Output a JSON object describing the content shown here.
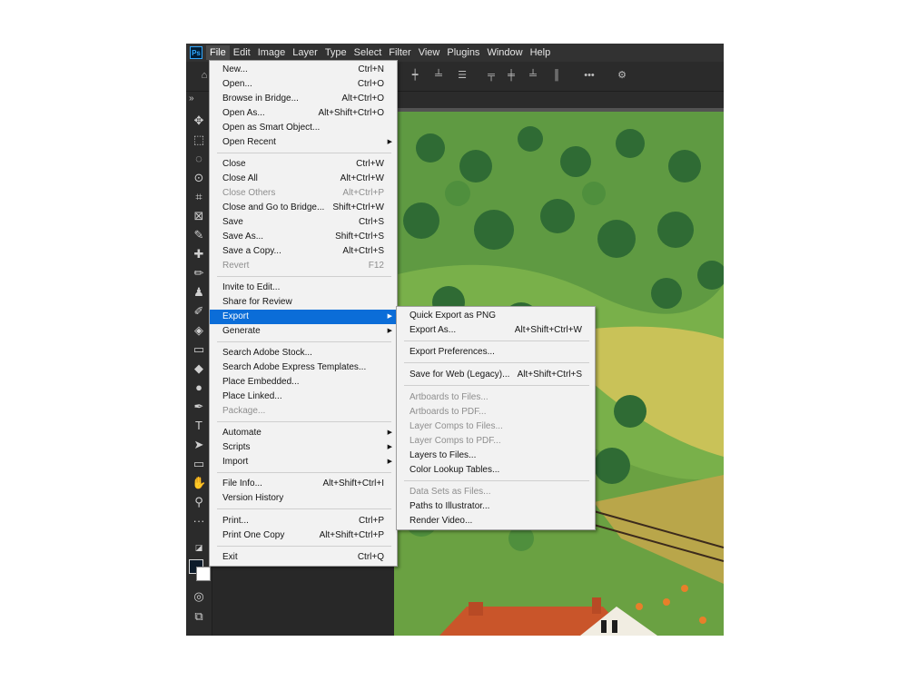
{
  "app": {
    "logo": "Ps"
  },
  "menubar": {
    "items": [
      "File",
      "Edit",
      "Image",
      "Layer",
      "Type",
      "Select",
      "Filter",
      "View",
      "Plugins",
      "Window",
      "Help"
    ],
    "active": "File"
  },
  "file_menu": {
    "items": [
      {
        "label": "New...",
        "shortcut": "Ctrl+N"
      },
      {
        "label": "Open...",
        "shortcut": "Ctrl+O"
      },
      {
        "label": "Browse in Bridge...",
        "shortcut": "Alt+Ctrl+O"
      },
      {
        "label": "Open As...",
        "shortcut": "Alt+Shift+Ctrl+O"
      },
      {
        "label": "Open as Smart Object...",
        "shortcut": ""
      },
      {
        "label": "Open Recent",
        "shortcut": ""
      },
      {
        "label": "Close",
        "shortcut": "Ctrl+W"
      },
      {
        "label": "Close All",
        "shortcut": "Alt+Ctrl+W"
      },
      {
        "label": "Close Others",
        "shortcut": "Alt+Ctrl+P"
      },
      {
        "label": "Close and Go to Bridge...",
        "shortcut": "Shift+Ctrl+W"
      },
      {
        "label": "Save",
        "shortcut": "Ctrl+S"
      },
      {
        "label": "Save As...",
        "shortcut": "Shift+Ctrl+S"
      },
      {
        "label": "Save a Copy...",
        "shortcut": "Alt+Ctrl+S"
      },
      {
        "label": "Revert",
        "shortcut": "F12"
      },
      {
        "label": "Invite to Edit...",
        "shortcut": ""
      },
      {
        "label": "Share for Review",
        "shortcut": ""
      },
      {
        "label": "Export",
        "shortcut": ""
      },
      {
        "label": "Generate",
        "shortcut": ""
      },
      {
        "label": "Search Adobe Stock...",
        "shortcut": ""
      },
      {
        "label": "Search Adobe Express Templates...",
        "shortcut": ""
      },
      {
        "label": "Place Embedded...",
        "shortcut": ""
      },
      {
        "label": "Place Linked...",
        "shortcut": ""
      },
      {
        "label": "Package...",
        "shortcut": ""
      },
      {
        "label": "Automate",
        "shortcut": ""
      },
      {
        "label": "Scripts",
        "shortcut": ""
      },
      {
        "label": "Import",
        "shortcut": ""
      },
      {
        "label": "File Info...",
        "shortcut": "Alt+Shift+Ctrl+I"
      },
      {
        "label": "Version History",
        "shortcut": ""
      },
      {
        "label": "Print...",
        "shortcut": "Ctrl+P"
      },
      {
        "label": "Print One Copy",
        "shortcut": "Alt+Shift+Ctrl+P"
      },
      {
        "label": "Exit",
        "shortcut": "Ctrl+Q"
      }
    ]
  },
  "export_submenu": {
    "items": [
      {
        "label": "Quick Export as PNG",
        "shortcut": ""
      },
      {
        "label": "Export As...",
        "shortcut": "Alt+Shift+Ctrl+W"
      },
      {
        "label": "Export Preferences...",
        "shortcut": ""
      },
      {
        "label": "Save for Web (Legacy)...",
        "shortcut": "Alt+Shift+Ctrl+S"
      },
      {
        "label": "Artboards to Files...",
        "shortcut": ""
      },
      {
        "label": "Artboards to PDF...",
        "shortcut": ""
      },
      {
        "label": "Layer Comps to Files...",
        "shortcut": ""
      },
      {
        "label": "Layer Comps to PDF...",
        "shortcut": ""
      },
      {
        "label": "Layers to Files...",
        "shortcut": ""
      },
      {
        "label": "Color Lookup Tables...",
        "shortcut": ""
      },
      {
        "label": "Data Sets as Files...",
        "shortcut": ""
      },
      {
        "label": "Paths to Illustrator...",
        "shortcut": ""
      },
      {
        "label": "Render Video...",
        "shortcut": ""
      }
    ]
  },
  "colors": {
    "highlight": "#0b6dd8",
    "menu_bg": "#f2f2f2",
    "disabled": "#8e8e8e"
  }
}
